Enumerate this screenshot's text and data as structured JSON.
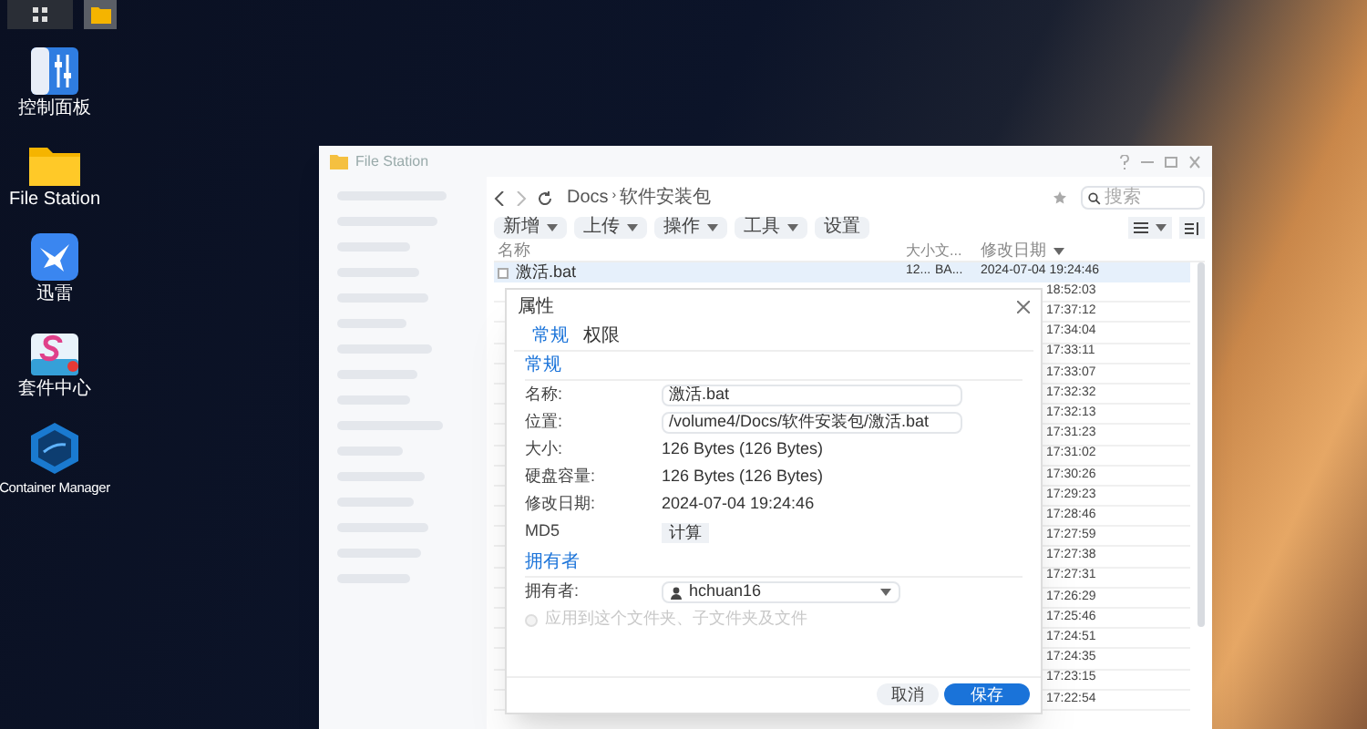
{
  "taskbar": {
    "items": [
      {
        "kind": "apps",
        "selected": false
      },
      {
        "kind": "folder",
        "selected": true
      }
    ]
  },
  "desktop_icons": [
    {
      "kind": "control",
      "label": "控制面板"
    },
    {
      "kind": "folder",
      "label": "File Station"
    },
    {
      "kind": "bird",
      "label": "迅雷"
    },
    {
      "kind": "store",
      "label": "套件中心"
    },
    {
      "kind": "container",
      "label": "Container Manager"
    }
  ],
  "window": {
    "title": "File Station",
    "path": [
      "Docs",
      "软件安装包"
    ],
    "path_separator": "›",
    "search": {
      "placeholder": "搜索"
    },
    "toolbar": [
      {
        "label": "新增",
        "dropdown": true
      },
      {
        "label": "上传",
        "dropdown": true
      },
      {
        "label": "操作",
        "dropdown": true
      },
      {
        "label": "工具",
        "dropdown": true
      },
      {
        "label": "设置",
        "dropdown": false
      }
    ],
    "table": {
      "columns": [
        "名称",
        "大小",
        "文...",
        "修改日期"
      ],
      "first_row": {
        "name": "激活.bat",
        "size": "12...",
        "type": "BA...",
        "date": "2024-07-04 19:24:46",
        "selected": true
      },
      "times": [
        "18:52:03",
        "17:37:12",
        "17:34:04",
        "17:33:11",
        "17:33:07",
        "17:32:32",
        "17:32:13",
        "17:31:23",
        "17:31:02",
        "17:30:26",
        "17:29:23",
        "17:28:46",
        "17:27:59",
        "17:27:38",
        "17:27:31",
        "17:26:29",
        "17:25:46",
        "17:24:51",
        "17:24:35",
        "17:23:15",
        "17:22:54"
      ]
    }
  },
  "dialog": {
    "title": "属性",
    "tabs": [
      {
        "label": "常规",
        "selected": true
      },
      {
        "label": "权限",
        "selected": false
      }
    ],
    "section_general": "常规",
    "fields": [
      {
        "kind": "input",
        "label": "名称:",
        "value": "激活.bat"
      },
      {
        "kind": "input",
        "label": "位置:",
        "value": "/volume4/Docs/软件安装包/激活.bat"
      },
      {
        "kind": "text",
        "label": "大小:",
        "value": "126 Bytes (126 Bytes)"
      },
      {
        "kind": "text",
        "label": "硬盘容量:",
        "value": "126 Bytes (126 Bytes)"
      },
      {
        "kind": "text",
        "label": "修改日期:",
        "value": "2024-07-04 19:24:46"
      },
      {
        "kind": "button",
        "label": "MD5",
        "value": "计算"
      }
    ],
    "section_owner": "拥有者",
    "owner": {
      "label": "拥有者:",
      "value": "hchuan16"
    },
    "apply_checkbox": {
      "label": "应用到这个文件夹、子文件夹及文件",
      "checked": false,
      "disabled": true
    },
    "buttons": [
      {
        "label": "取消",
        "kind": "secondary"
      },
      {
        "label": "保存",
        "kind": "primary"
      }
    ]
  }
}
